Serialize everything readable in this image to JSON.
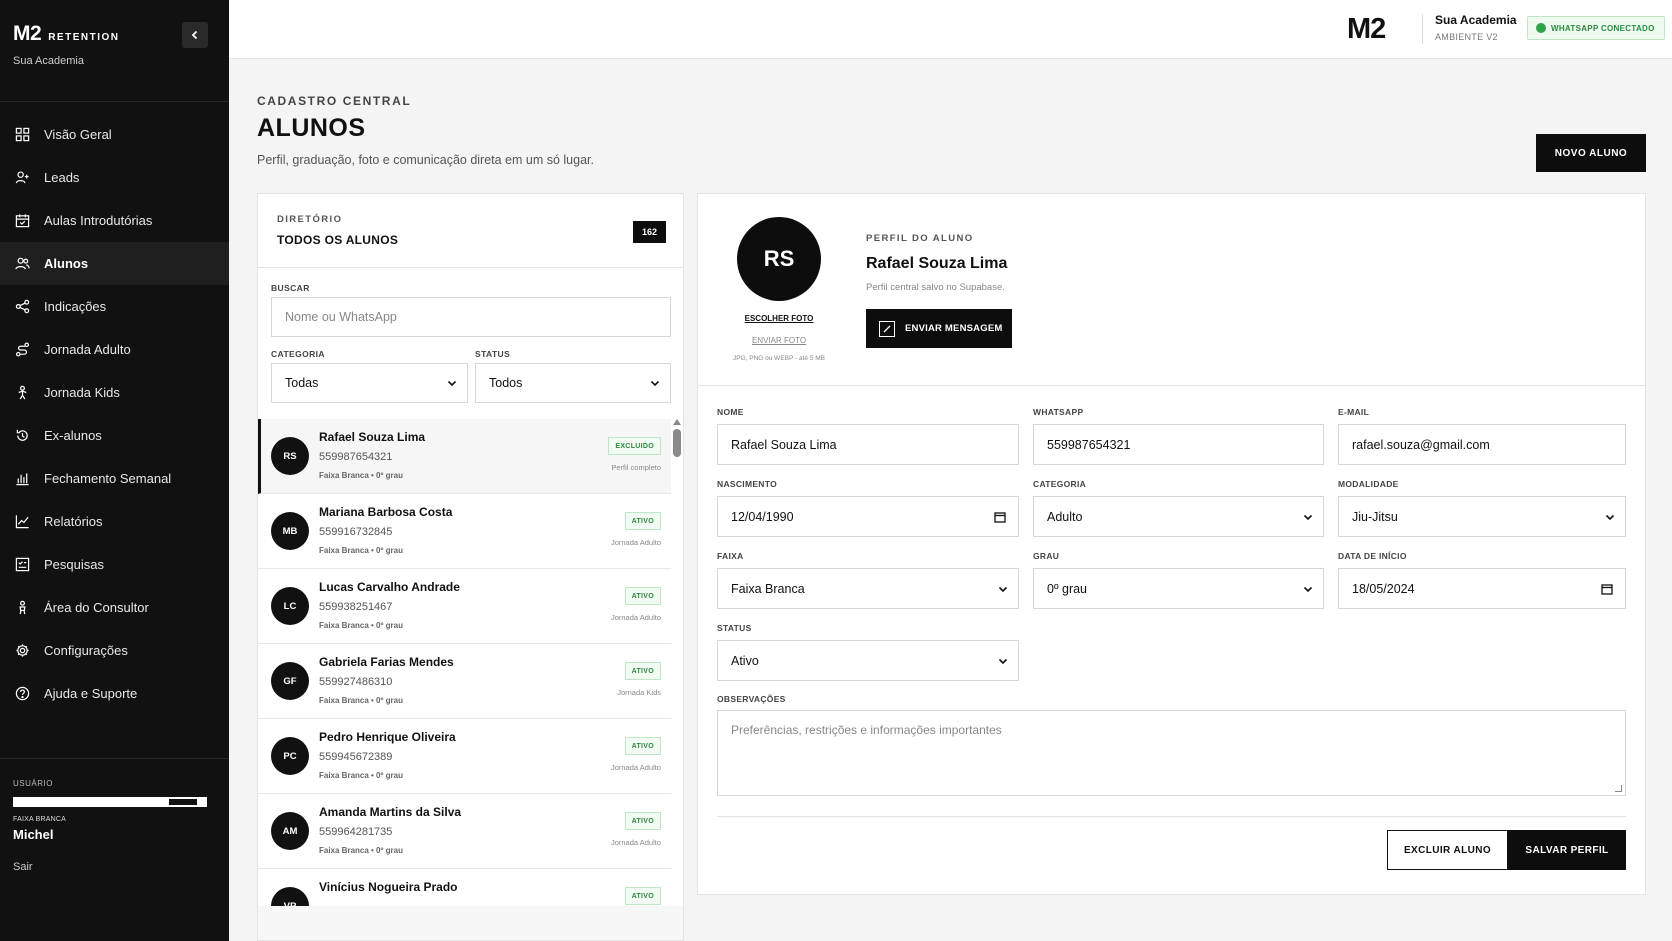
{
  "sidebar": {
    "logo_main": "M2",
    "logo_sub": "RETENTION",
    "academy": "Sua Academia",
    "collapse_icon": "chevron-left-icon",
    "items": [
      {
        "label": "Visão Geral",
        "icon": "grid-icon"
      },
      {
        "label": "Leads",
        "icon": "user-plus-icon"
      },
      {
        "label": "Aulas Introdutórias",
        "icon": "calendar-icon"
      },
      {
        "label": "Alunos",
        "icon": "users-icon",
        "active": true
      },
      {
        "label": "Indicações",
        "icon": "share-icon"
      },
      {
        "label": "Jornada Adulto",
        "icon": "route-icon"
      },
      {
        "label": "Jornada Kids",
        "icon": "child-icon"
      },
      {
        "label": "Ex-alunos",
        "icon": "history-icon"
      },
      {
        "label": "Fechamento Semanal",
        "icon": "bar-chart-icon"
      },
      {
        "label": "Relatórios",
        "icon": "line-chart-icon"
      },
      {
        "label": "Pesquisas",
        "icon": "survey-icon"
      },
      {
        "label": "Área do Consultor",
        "icon": "consultant-icon"
      },
      {
        "label": "Configurações",
        "icon": "gear-icon"
      },
      {
        "label": "Ajuda e Suporte",
        "icon": "help-icon"
      }
    ],
    "user": {
      "label": "USUÁRIO",
      "belt": "FAIXA BRANCA",
      "name": "Michel",
      "logout": "Sair"
    }
  },
  "topbar": {
    "logo": "M2",
    "academy": "Sua Academia",
    "environment": "AMBIENTE V2",
    "whatsapp_status": "WHATSAPP CONECTADO",
    "whatsapp_color": "#2fa24a"
  },
  "header": {
    "eyebrow": "CADASTRO CENTRAL",
    "title": "ALUNOS",
    "description": "Perfil, graduação, foto e comunicação direta em um só lugar.",
    "new_button": "NOVO ALUNO"
  },
  "directory": {
    "eyebrow": "DIRETÓRIO",
    "title": "TODOS OS ALUNOS",
    "count": "162",
    "search_label": "BUSCAR",
    "search_placeholder": "Nome ou WhatsApp",
    "category_label": "CATEGORIA",
    "category_value": "Todas",
    "status_label": "STATUS",
    "status_value": "Todos",
    "students": [
      {
        "initials": "RS",
        "name": "Rafael Souza Lima",
        "phone": "559987654321",
        "belt": "Faixa Branca • 0º grau",
        "badge": "EXCLUIDO",
        "journey": "Perfil completo",
        "selected": true
      },
      {
        "initials": "MB",
        "name": "Mariana Barbosa Costa",
        "phone": "559916732845",
        "belt": "Faixa Branca • 0º grau",
        "badge": "ATIVO",
        "journey": "Jornada Adulto"
      },
      {
        "initials": "LC",
        "name": "Lucas Carvalho Andrade",
        "phone": "559938251467",
        "belt": "Faixa Branca • 0º grau",
        "badge": "ATIVO",
        "journey": "Jornada Adulto"
      },
      {
        "initials": "GF",
        "name": "Gabriela Farias Mendes",
        "phone": "559927486310",
        "belt": "Faixa Branca • 0º grau",
        "badge": "ATIVO",
        "journey": "Jornada Kids"
      },
      {
        "initials": "PC",
        "name": "Pedro Henrique Oliveira",
        "phone": "559945672389",
        "belt": "Faixa Branca • 0º grau",
        "badge": "ATIVO",
        "journey": "Jornada Adulto"
      },
      {
        "initials": "AM",
        "name": "Amanda Martins da Silva",
        "phone": "559964281735",
        "belt": "Faixa Branca • 0º grau",
        "badge": "ATIVO",
        "journey": "Jornada Adulto"
      },
      {
        "initials": "VP",
        "name": "Vinícius Nogueira Prado",
        "phone": "",
        "belt": "",
        "badge": "ATIVO",
        "journey": ""
      }
    ]
  },
  "profile": {
    "initials": "RS",
    "choose_photo": "ESCOLHER FOTO",
    "send_photo": "ENVIAR FOTO",
    "photo_hint": "JPG, PNG ou WEBP - até 5 MB",
    "eyebrow": "PERFIL DO ALUNO",
    "name": "Rafael Souza Lima",
    "saved_note": "Perfil central salvo no Supabase.",
    "message_button": "ENVIAR MENSAGEM",
    "fields": {
      "nome_label": "NOME",
      "nome": "Rafael Souza Lima",
      "whatsapp_label": "WHATSAPP",
      "whatsapp": "559987654321",
      "email_label": "E-MAIL",
      "email": "rafael.souza@gmail.com",
      "nascimento_label": "NASCIMENTO",
      "nascimento": "12/04/1990",
      "categoria_label": "CATEGORIA",
      "categoria": "Adulto",
      "modalidade_label": "MODALIDADE",
      "modalidade": "Jiu-Jitsu",
      "faixa_label": "FAIXA",
      "faixa": "Faixa Branca",
      "grau_label": "GRAU",
      "grau": "0º grau",
      "inicio_label": "DATA DE INÍCIO",
      "inicio": "18/05/2024",
      "status_label": "STATUS",
      "status": "Ativo",
      "obs_label": "OBSERVAÇÕES",
      "obs_placeholder": "Preferências, restrições e informações importantes"
    },
    "delete_button": "EXCLUIR ALUNO",
    "save_button": "SALVAR PERFIL"
  }
}
